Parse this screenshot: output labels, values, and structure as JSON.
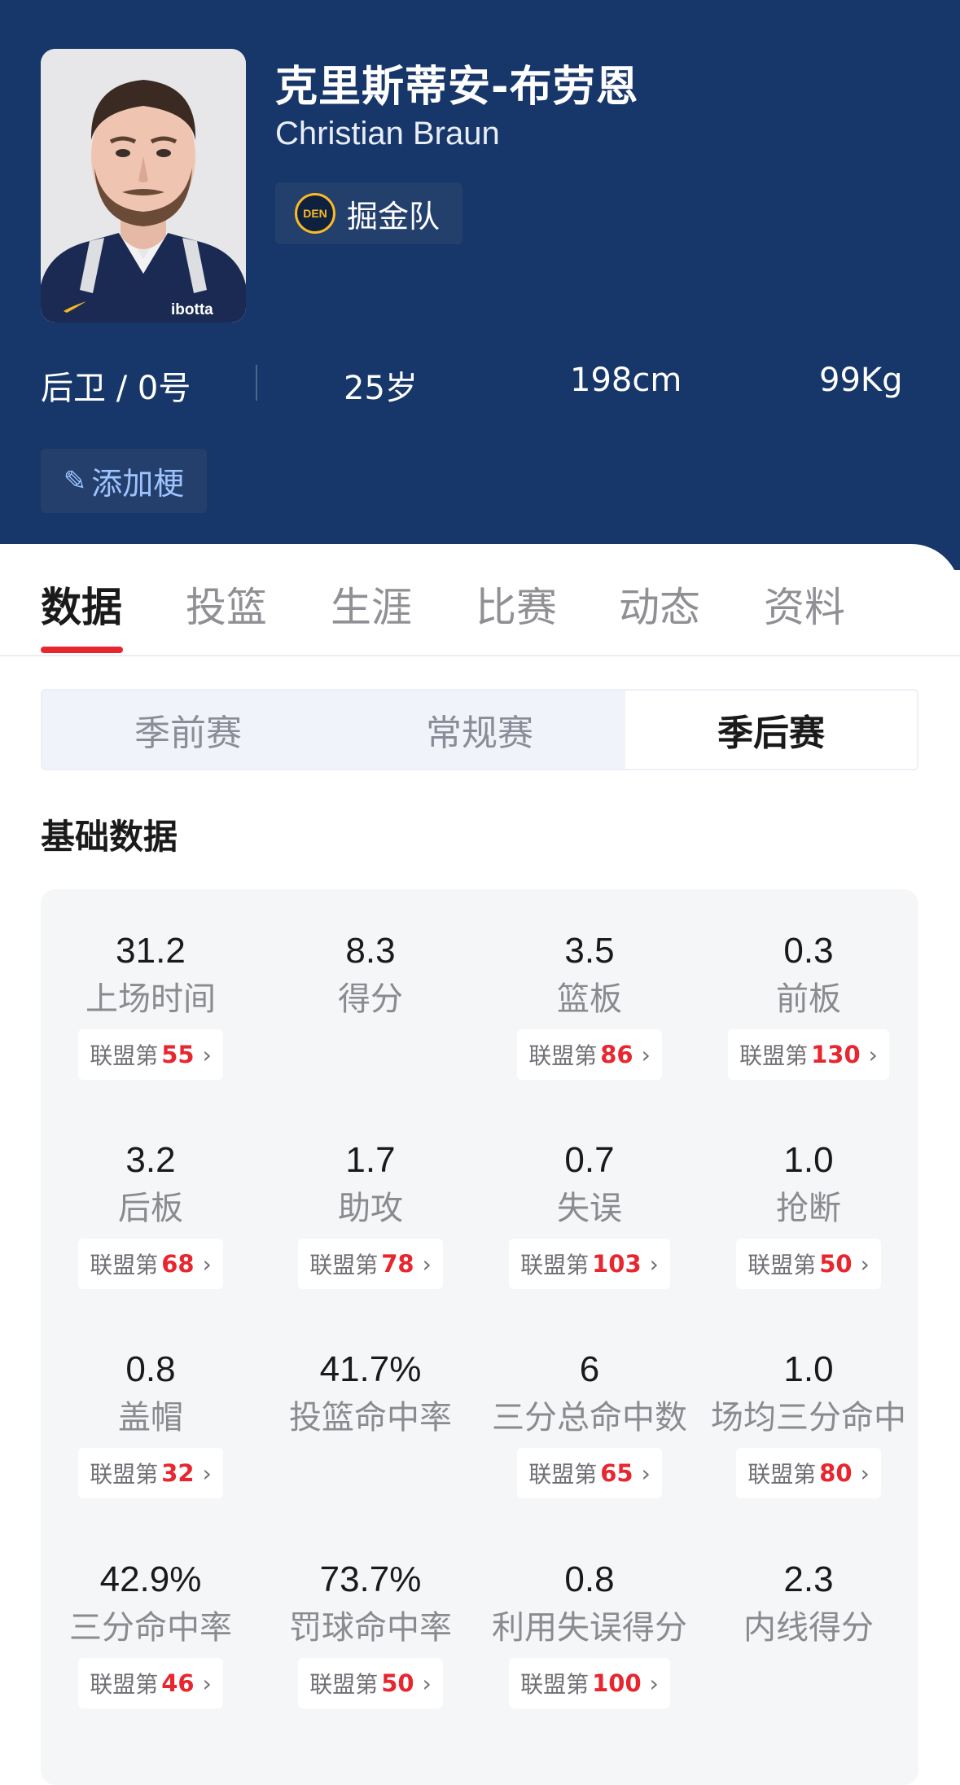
{
  "player": {
    "name_cn": "克里斯蒂安-布劳恩",
    "name_en": "Christian Braun",
    "team": "掘金队",
    "team_abbr": "DEN",
    "jersey_text": "ibotta",
    "position": "后卫 / 0号",
    "age": "25岁",
    "height": "198cm",
    "weight": "99Kg",
    "add_meme_label": "添加梗"
  },
  "tabs": [
    "数据",
    "投篮",
    "生涯",
    "比赛",
    "动态",
    "资料"
  ],
  "active_tab": "数据",
  "segments": [
    "季前赛",
    "常规赛",
    "季后赛"
  ],
  "active_segment": "季后赛",
  "section_title": "基础数据",
  "rank_prefix": "联盟第",
  "stats": [
    {
      "value": "31.2",
      "label": "上场时间",
      "rank": "55"
    },
    {
      "value": "8.3",
      "label": "得分",
      "rank": null
    },
    {
      "value": "3.5",
      "label": "篮板",
      "rank": "86"
    },
    {
      "value": "0.3",
      "label": "前板",
      "rank": "130"
    },
    {
      "value": "3.2",
      "label": "后板",
      "rank": "68"
    },
    {
      "value": "1.7",
      "label": "助攻",
      "rank": "78"
    },
    {
      "value": "0.7",
      "label": "失误",
      "rank": "103"
    },
    {
      "value": "1.0",
      "label": "抢断",
      "rank": "50"
    },
    {
      "value": "0.8",
      "label": "盖帽",
      "rank": "32"
    },
    {
      "value": "41.7%",
      "label": "投篮命中率",
      "rank": null
    },
    {
      "value": "6",
      "label": "三分总命中数",
      "rank": "65"
    },
    {
      "value": "1.0",
      "label": "场均三分命中",
      "rank": "80"
    },
    {
      "value": "42.9%",
      "label": "三分命中率",
      "rank": "46"
    },
    {
      "value": "73.7%",
      "label": "罚球命中率",
      "rank": "50"
    },
    {
      "value": "0.8",
      "label": "利用失误得分",
      "rank": "100"
    },
    {
      "value": "2.3",
      "label": "内线得分",
      "rank": null
    }
  ],
  "colors": {
    "header_bg": "#17376a",
    "accent_red": "#e8262f",
    "team_gold": "#fdb927"
  }
}
